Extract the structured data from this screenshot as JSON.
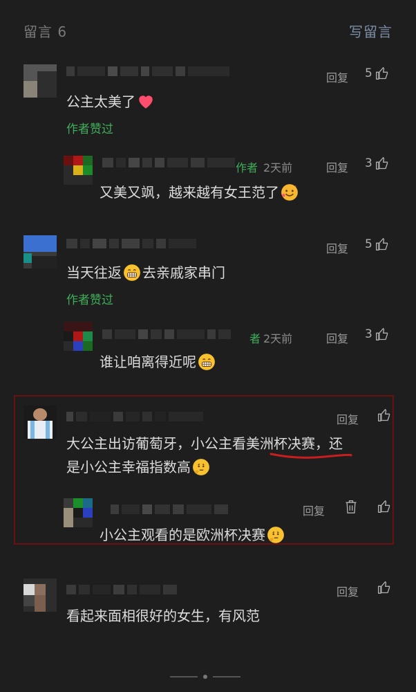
{
  "header": {
    "title": "留言 6",
    "write_label": "写留言"
  },
  "comments": [
    {
      "content": "公主太美了",
      "liked_by_author": "作者赞过",
      "reply_label": "回复",
      "likes": "5",
      "reply": {
        "author_tag": "作者",
        "time": "2天前",
        "content": "又美又飒，越来越有女王范了",
        "reply_label": "回复",
        "likes": "3"
      }
    },
    {
      "content_part1": "当天往返",
      "content_part2": "去亲戚家串门",
      "liked_by_author": "作者赞过",
      "reply_label": "回复",
      "likes": "5",
      "reply": {
        "author_tag": "者",
        "time": "2天前",
        "content": "谁让咱离得近呢",
        "reply_label": "回复",
        "likes": "3"
      }
    },
    {
      "content_line1_a": "大公主出访葡萄牙，小公主看",
      "content_line1_b": "美洲杯决赛",
      "content_line1_c": "，还",
      "content_line2": "是小公主幸福指数高",
      "reply_label": "回复",
      "reply": {
        "content": "小公主观看的是欧洲杯决赛",
        "reply_label": "回复"
      }
    },
    {
      "content": "看起来面相很好的女生，有风范",
      "reply_label": "回复"
    }
  ],
  "colors": {
    "background": "#1e1e1e",
    "author_green": "#3fae5a",
    "highlight_box": "#6a1111",
    "underline_red": "#c81e1e"
  },
  "icons": [
    "thumbs-up-icon",
    "trash-icon",
    "heart-emoji",
    "smiling-hearts-emoji",
    "grin-emoji",
    "thinking-emoji"
  ]
}
